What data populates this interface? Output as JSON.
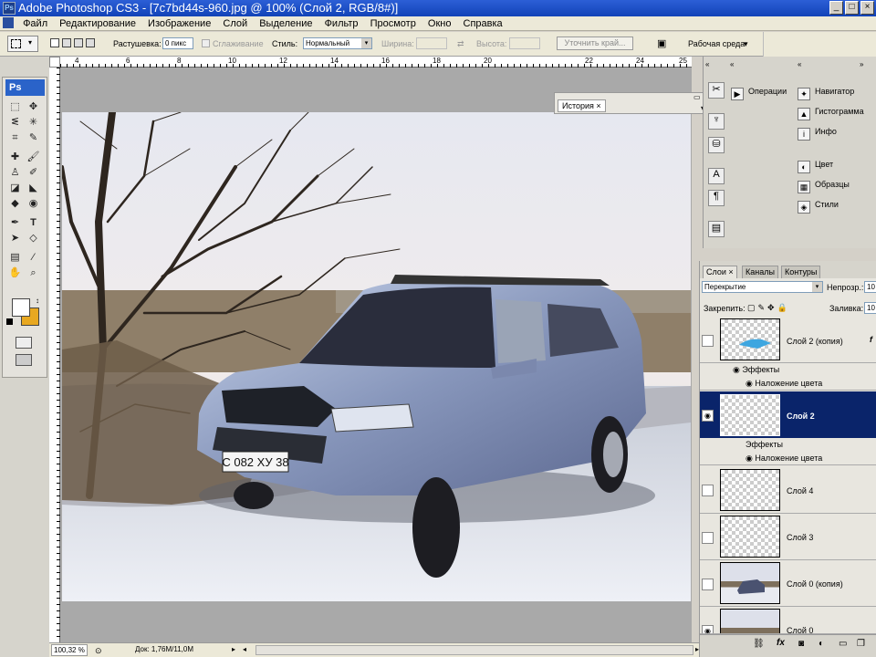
{
  "window": {
    "title": "Adobe Photoshop CS3 - [7c7bd44s-960.jpg @ 100% (Слой 2, RGB/8#)]"
  },
  "menu": [
    "Файл",
    "Редактирование",
    "Изображение",
    "Слой",
    "Выделение",
    "Фильтр",
    "Просмотр",
    "Окно",
    "Справка"
  ],
  "options": {
    "feather_label": "Растушевка:",
    "feather_value": "0 пикс",
    "antialias_label": "Сглаживание",
    "style_label": "Стиль:",
    "style_value": "Нормальный",
    "width_label": "Ширина:",
    "height_label": "Высота:",
    "refine_button": "Уточнить край...",
    "workspace_label": "Рабочая среда"
  },
  "ruler": {
    "ticks": [
      "4",
      "6",
      "8",
      "10",
      "12",
      "14",
      "16",
      "18",
      "20",
      "22",
      "24",
      "25"
    ]
  },
  "toolbox": {
    "logo": "Ps"
  },
  "history_panel": {
    "tab": "История"
  },
  "dock": {
    "col2": [
      "Операции"
    ],
    "col3": [
      "Навигатор",
      "Гистограмма",
      "Инфо",
      "Цвет",
      "Образцы",
      "Стили"
    ]
  },
  "layers_panel": {
    "tabs": [
      "Слои",
      "Каналы",
      "Контуры"
    ],
    "blend_mode": "Перекрытие",
    "opacity_label": "Непрозр.:",
    "opacity_value": "10",
    "lock_label": "Закрепить:",
    "fill_label": "Заливка:",
    "fill_value": "10",
    "layers": [
      {
        "name": "Слой 2 (копия)"
      },
      {
        "name": "Слой 2"
      },
      {
        "name": "Слой 4"
      },
      {
        "name": "Слой 3"
      },
      {
        "name": "Слой 0 (копия)"
      },
      {
        "name": "Слой 0"
      }
    ],
    "effects_label": "Эффекты",
    "effect_name": "Наложение цвета"
  },
  "status": {
    "zoom": "100,32 %",
    "doc": "Док: 1,76M/11,0M"
  },
  "photo": {
    "plate": "С 082 ХУ 38"
  }
}
